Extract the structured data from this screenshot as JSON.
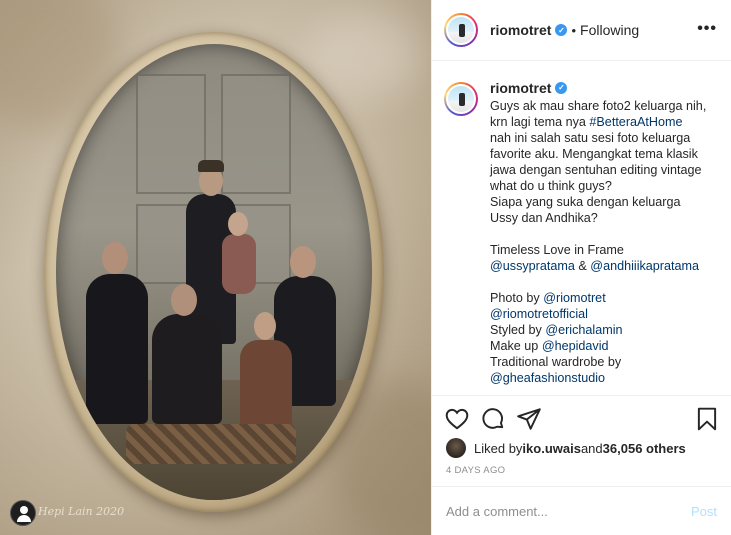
{
  "photo": {
    "watermark": "Hepi Lain 2020"
  },
  "header": {
    "username": "riomotret",
    "separator": "•",
    "follow_status": "Following",
    "more_label": "•••"
  },
  "caption": {
    "username": "riomotret",
    "lines": [
      "Guys ak mau share foto2 keluarga nih,",
      "krn lagi tema nya ",
      "#BetteraAtHome",
      "nah ini salah satu sesi foto keluarga\nfavorite aku. Mengangkat tema klasik\njawa dengan sentuhan editing vintage\nwhat do u think guys?\nSiapa yang suka dengan keluarga\nUssy dan Andhika?",
      "Timeless Love in Frame",
      "@ussypratama",
      " & ",
      "@andhiiikapratama",
      "Photo by ",
      "@riomotret",
      "@riomotretofficial",
      "Styled by ",
      "@erichalamin",
      "Make up ",
      "@hepidavid",
      "Traditional wardrobe by",
      "@gheafashionstudio"
    ]
  },
  "likes": {
    "prefix": "Liked by ",
    "user": "iko.uwais",
    "middle": " and ",
    "count": "36,056 others"
  },
  "timestamp": "4 DAYS AGO",
  "comment": {
    "placeholder": "Add a comment...",
    "post_label": "Post"
  },
  "colors": {
    "link": "#00376b",
    "verified": "#3897f0",
    "muted": "#8e8e8e",
    "post_disabled": "#b2dffc"
  },
  "icons": [
    "heart-icon",
    "comment-icon",
    "share-icon",
    "bookmark-icon",
    "more-options-icon",
    "verified-badge-icon"
  ]
}
